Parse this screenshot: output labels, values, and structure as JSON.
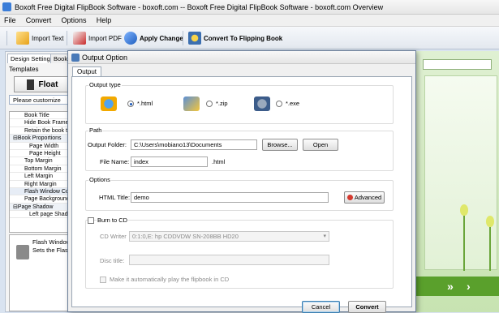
{
  "app": {
    "title": "Boxoft Free Digital FlipBook Software - boxoft.com -- Boxoft Free Digital FlipBook Software - boxoft.com Overview",
    "menu": [
      "File",
      "Convert",
      "Options",
      "Help"
    ]
  },
  "toolbar": {
    "import_text": "Import Text",
    "import_pdf": "Import PDF",
    "apply_change": "Apply Change",
    "convert": "Convert To Flipping Book"
  },
  "left_panel": {
    "tabs": [
      "Design Setting",
      "Bookt"
    ],
    "templates_label": "Templates",
    "float_label": "Float",
    "customize_label": "Please customize",
    "properties": [
      {
        "label": "Book Title",
        "level": 1
      },
      {
        "label": "Hide Book Frame B",
        "level": 1
      },
      {
        "label": "Retain the book to",
        "level": 1
      },
      {
        "label": "⊟Book Proportions",
        "level": 0
      },
      {
        "label": "Page Width",
        "level": 2
      },
      {
        "label": "Page Height",
        "level": 2
      },
      {
        "label": "Top Margin",
        "level": 1
      },
      {
        "label": "Bottom Margin",
        "level": 1
      },
      {
        "label": "Left Margin",
        "level": 1
      },
      {
        "label": "Right Margin",
        "level": 1
      },
      {
        "label": "Flash Window Colo",
        "level": 1,
        "selected": true
      },
      {
        "label": "Page Background C",
        "level": 1
      },
      {
        "label": "⊟Page Shadow",
        "level": 0
      },
      {
        "label": "Left page Shadov",
        "level": 2
      }
    ],
    "hint_title": "Flash Window",
    "hint_text": "Sets the Flas"
  },
  "dialog": {
    "title": "Output Option",
    "tab": "Output",
    "output_type": {
      "title": "Output type",
      "options": [
        {
          "label": "*.html",
          "selected": true
        },
        {
          "label": "*.zip",
          "selected": false
        },
        {
          "label": "*.exe",
          "selected": false
        }
      ]
    },
    "path": {
      "title": "Path",
      "folder_label": "Output Folder:",
      "folder_value": "C:\\Users\\mobiano13\\Documents",
      "browse": "Browse...",
      "open": "Open",
      "filename_label": "File Name:",
      "filename_value": "index",
      "extension": ".html"
    },
    "options": {
      "title": "Options",
      "html_title_label": "HTML Title:",
      "html_title_value": "demo",
      "advanced": "Advanced"
    },
    "burn": {
      "label": "Burn to CD",
      "cd_writer_label": "CD Writer",
      "cd_writer_value": "0:1:0,E: hp      CDDVDW SN-208BB  HD20",
      "disc_title_label": "Disc title:",
      "disc_title_value": "",
      "autoplay_label": "Make it automatically play the flipbook in CD"
    },
    "cancel": "Cancel",
    "convert": "Convert"
  },
  "colors": {
    "accent": "#1a57b8",
    "preview_green": "#5aa02c",
    "preview_bg": "#dff0d2"
  }
}
